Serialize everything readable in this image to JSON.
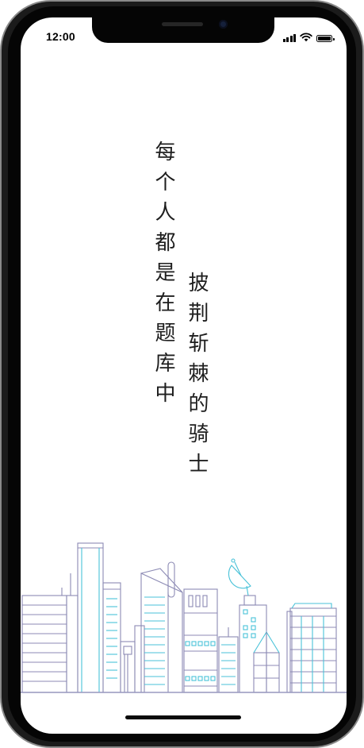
{
  "status_bar": {
    "time": "12:00",
    "icons": [
      "signal-icon",
      "wifi-icon",
      "battery-icon"
    ]
  },
  "content": {
    "line_1": "每个人都是在题库中",
    "line_2": "披荆斩棘的骑士"
  },
  "illustration": {
    "name": "city-skyline",
    "colors": {
      "outline": "#8c8ab4",
      "accent": "#49c2d8",
      "ground": "#9a9ac0"
    }
  }
}
